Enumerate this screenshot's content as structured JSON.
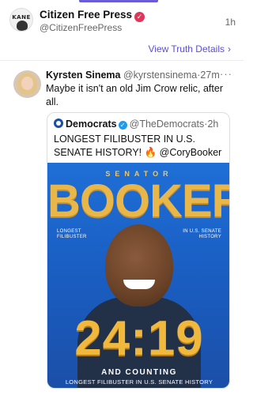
{
  "header": {
    "name": "Citizen Free Press",
    "handle": "@CitizenFreePress",
    "time": "1h",
    "avatar_text": "KANE"
  },
  "actions": {
    "view_details": "View Truth Details"
  },
  "post": {
    "author_name": "Kyrsten Sinema",
    "author_handle": "@kyrstensinema",
    "time": "·27m",
    "text": "Maybe it isn't an old Jim Crow relic, after all."
  },
  "quote": {
    "author_name": "Democrats",
    "author_handle": "@TheDemocrats",
    "time": "·2h",
    "text": "LONGEST FILIBUSTER IN U.S. SENATE HISTORY! 🔥 @CoryBooker",
    "image": {
      "senator": "SENATOR",
      "booker": "BOOKER",
      "sub_left_1": "LONGEST",
      "sub_left_2": "FILIBUSTER",
      "sub_right_1": "IN U.S. SENATE",
      "sub_right_2": "HISTORY",
      "score": "24:19",
      "counting": "AND COUNTING",
      "tagline": "LONGEST FILIBUSTER IN U.S. SENATE HISTORY"
    }
  },
  "colors": {
    "accent": "#5b4fd6",
    "verified_red": "#e0365a",
    "verified_blue": "#1d9bf0",
    "poster_blue": "#1f6fd6",
    "poster_gold": "#e9b64a"
  }
}
